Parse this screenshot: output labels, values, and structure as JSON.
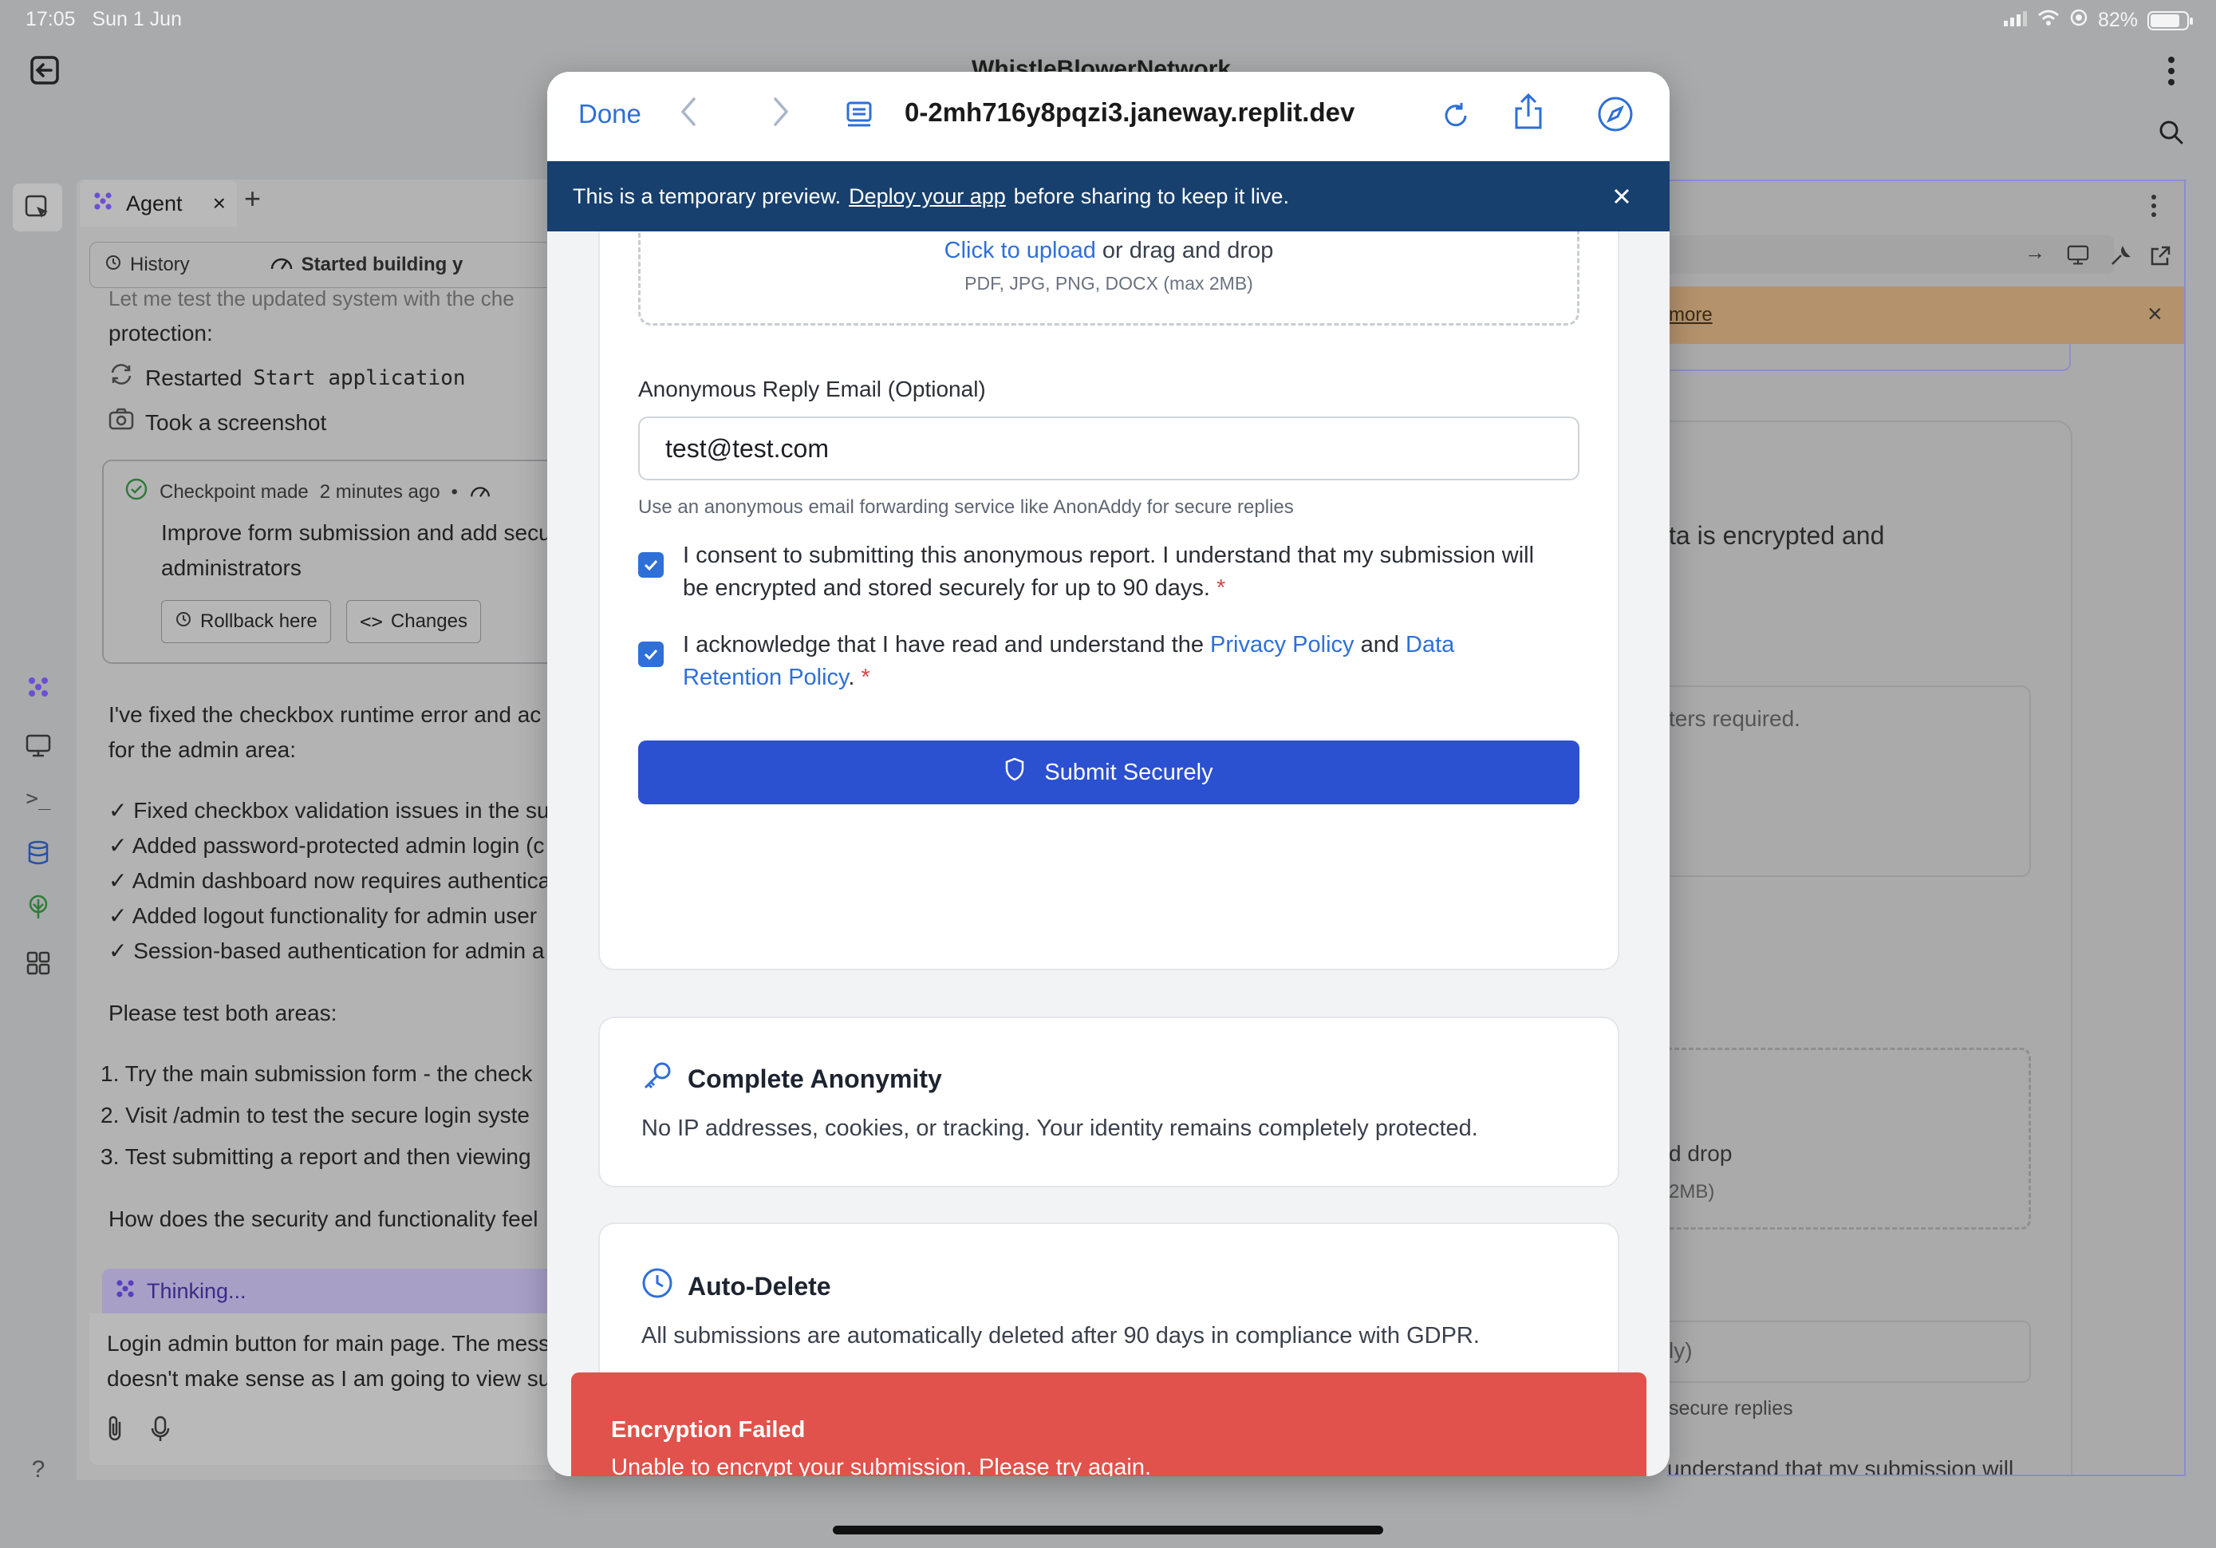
{
  "status_bar": {
    "time": "17:05",
    "date": "Sun 1 Jun",
    "battery": "82%",
    "battery_level": 0.82
  },
  "app": {
    "title": "WhistleBlowerNetwork"
  },
  "agent_panel": {
    "tab_label": "Agent",
    "history_label": "History",
    "started_label": "Started building y",
    "log_top": "Let me test the updated system with the che",
    "log_protection": "protection:",
    "restarted": "Restarted",
    "restarted_code": "Start application",
    "screenshot": "Took a screenshot",
    "checkpoint_label": "Checkpoint made",
    "checkpoint_time": "2 minutes ago",
    "checkpoint_desc_1": "Improve form submission and add secu",
    "checkpoint_desc_2": "administrators",
    "rollback_label": "Rollback here",
    "changes_label": "Changes",
    "msg_1": "I've fixed the checkbox runtime error and ac",
    "msg_2": "for the admin area:",
    "bullets": [
      "✓ Fixed checkbox validation issues in the su",
      "✓ Added password-protected admin login (c",
      "✓ Admin dashboard now requires authentica",
      "✓ Added logout functionality for admin user",
      "✓ Session-based authentication for admin a"
    ],
    "test_intro": "Please test both areas:",
    "steps": [
      "1.  Try the main submission form - the check",
      "2.  Visit /admin to test the secure login syste",
      "3.  Test submitting a report and then viewing"
    ],
    "question": "How does the security and functionality feel",
    "thinking": "Thinking...",
    "input_1": "Login admin button for main page. The mess",
    "input_2": "doesn't make sense as I am going to view su"
  },
  "right_panel": {
    "banner_link": "more",
    "text_encrypted": "ta is encrypted and",
    "text_chars": "ters required.",
    "text_drop": "d drop",
    "text_2mb": "2MB)",
    "text_ly": "ly)",
    "text_secure": "secure replies",
    "text_bottom": "understand that my submission will"
  },
  "browser": {
    "done_label": "Done",
    "url": "0-2mh716y8pqzi3.janeway.replit.dev",
    "banner_prefix": "This is a temporary preview.",
    "banner_link": "Deploy your app",
    "banner_suffix": "before sharing to keep it live."
  },
  "form": {
    "upload_link": "Click to upload",
    "upload_rest": "or drag and drop",
    "upload_types": "PDF, JPG, PNG, DOCX (max 2MB)",
    "email_label": "Anonymous Reply Email (Optional)",
    "email_value": "test@test.com",
    "email_help": "Use an anonymous email forwarding service like AnonAddy for secure replies",
    "consent_1_a": "I consent to submitting this anonymous report. I understand that my submission will",
    "consent_1_b": "be encrypted and stored securely for up to 90 days.",
    "consent_2_a": "I acknowledge that I have read and understand the",
    "privacy_link": "Privacy Policy",
    "and": "and",
    "data_link_a": "Data",
    "data_link_b": "Retention Policy",
    "required_mark": "*",
    "submit_label": "Submit Securely",
    "consent_checked": true
  },
  "features": [
    {
      "title": "Complete Anonymity",
      "desc": "No IP addresses, cookies, or tracking. Your identity remains completely protected."
    },
    {
      "title": "Auto-Delete",
      "desc": "All submissions are automatically deleted after 90 days in compliance with GDPR."
    }
  ],
  "toast": {
    "title": "Encryption Failed",
    "desc": "Unable to encrypt your submission. Please try again."
  },
  "colors": {
    "accent": "#2b50d0",
    "link": "#2f6fd8",
    "banner": "#17406f",
    "toast": "#e0524b"
  }
}
